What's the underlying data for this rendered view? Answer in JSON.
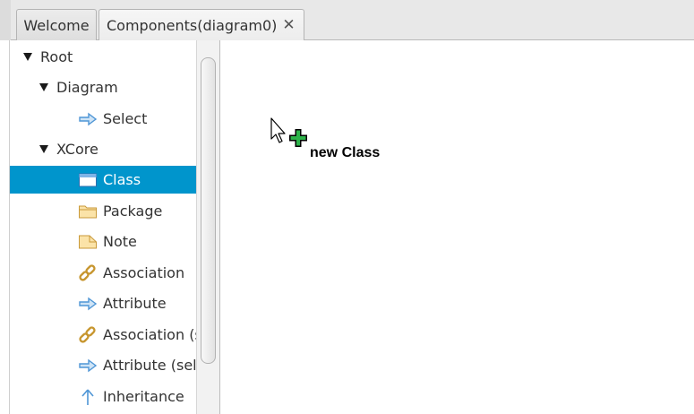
{
  "tabs": [
    {
      "label": "Welcome",
      "active": false
    },
    {
      "label": "Components(diagram0)",
      "active": true,
      "close": "✕"
    }
  ],
  "tree": {
    "root": {
      "label": "Root",
      "expanded": true
    },
    "diagram": {
      "label": "Diagram",
      "expanded": true
    },
    "select": {
      "label": "Select",
      "icon": "arrow-right-icon"
    },
    "xcore": {
      "label": "XCore",
      "expanded": true
    },
    "items": [
      {
        "label": "Class",
        "icon": "class-icon",
        "selected": true
      },
      {
        "label": "Package",
        "icon": "folder-icon"
      },
      {
        "label": "Note",
        "icon": "note-icon"
      },
      {
        "label": "Association",
        "icon": "chain-link-icon"
      },
      {
        "label": "Attribute",
        "icon": "arrow-right-icon"
      },
      {
        "label": "Association (s",
        "icon": "chain-link-icon"
      },
      {
        "label": "Attribute (sel",
        "icon": "arrow-right-icon"
      },
      {
        "label": "Inheritance",
        "icon": "arrow-up-icon"
      }
    ]
  },
  "canvas": {
    "drop_label": "new Class",
    "cursor_icon": "mouse-pointer-icon",
    "add_icon": "green-plus-icon"
  },
  "colors": {
    "selection": "#0095cc",
    "plus": "#2db34a",
    "arrow_icon": "#4f96d6"
  }
}
